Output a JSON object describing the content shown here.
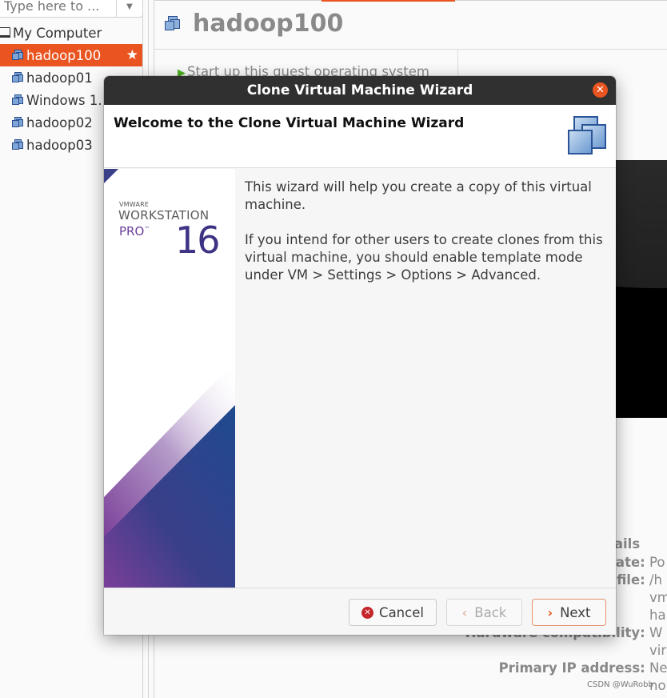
{
  "library": {
    "search": {
      "placeholder": "Type here to ...",
      "value": ""
    },
    "root": {
      "label": "My Computer",
      "icon": "computer-icon"
    },
    "items": [
      {
        "label": "hadoop100",
        "icon": "vm-icon",
        "selected": true,
        "favorite": true
      },
      {
        "label": "hadoop01",
        "icon": "vm-icon",
        "selected": false
      },
      {
        "label": "Windows 1.",
        "icon": "vm-icon",
        "selected": false
      },
      {
        "label": "hadoop02",
        "icon": "vm-icon",
        "selected": false
      },
      {
        "label": "hadoop03",
        "icon": "vm-icon",
        "selected": false
      }
    ],
    "favorite_glyph": "★"
  },
  "vm_page": {
    "title": "hadoop100",
    "start_action": "Start up this guest operating system",
    "details": {
      "heading": "tails",
      "rows": [
        {
          "key": "tate:",
          "value": "Po"
        },
        {
          "key": "n file:",
          "value": "/h"
        },
        {
          "key": "",
          "value": "vm"
        },
        {
          "key": "",
          "value": "ha"
        },
        {
          "key": "Hardware compatibility:",
          "value": "W"
        },
        {
          "key": "",
          "value": "vir"
        },
        {
          "key": "Primary IP address:",
          "value": "Ne"
        },
        {
          "key": "",
          "value": "no"
        }
      ]
    }
  },
  "dialog": {
    "title": "Clone Virtual Machine Wizard",
    "heading": "Welcome to the Clone Virtual Machine Wizard",
    "close_glyph": "✕",
    "brand": {
      "vendor": "VMWARE",
      "product": "WORKSTATION",
      "edition": "PRO",
      "tm": "™",
      "version": "16"
    },
    "paragraphs": [
      "This wizard will help you create a copy of this virtual machine.",
      "If you intend for other users to create clones from this virtual machine, you should enable template mode under VM > Settings > Options > Advanced."
    ],
    "buttons": {
      "cancel": "Cancel",
      "back": "Back",
      "next": "Next",
      "back_enabled": false,
      "default": "next"
    },
    "colors": {
      "accent": "#e95420",
      "titlebar": "#303030",
      "brand_blue": "#2b4d8e",
      "brand_purple": "#7b3f98"
    }
  },
  "watermark": "CSDN @WuRobb"
}
